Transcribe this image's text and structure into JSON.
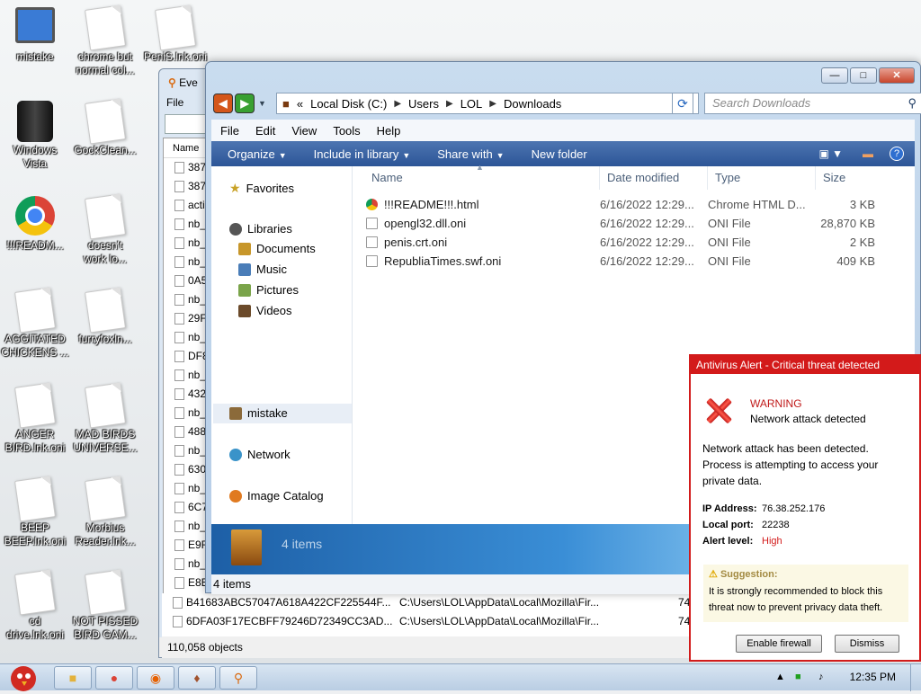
{
  "desktop": {
    "icons": [
      {
        "label": "mistake",
        "kind": "monitor"
      },
      {
        "label": "chrome but\nnormal col...",
        "kind": "page"
      },
      {
        "label": "PeniS.lnk.oni",
        "kind": "page"
      },
      {
        "label": "Windows\nVista",
        "kind": "can"
      },
      {
        "label": "GockClean...",
        "kind": "page"
      },
      {
        "label": "!!!READM...",
        "kind": "chrome"
      },
      {
        "label": "doesn't\nwork lo...",
        "kind": "page"
      },
      {
        "label": "AGGITATED\nCHICKENS ...",
        "kind": "page"
      },
      {
        "label": "furryfoxln...",
        "kind": "page"
      },
      {
        "label": "ANGER\nBIRD.lnk.oni",
        "kind": "page"
      },
      {
        "label": "MAD BIRDS\nUNIVERSE...",
        "kind": "page"
      },
      {
        "label": "BEEP\nBEEP.lnk.oni",
        "kind": "page"
      },
      {
        "label": "Morbius\nReader.lnk...",
        "kind": "page"
      },
      {
        "label": "cd\ndrive.lnk.oni",
        "kind": "page"
      },
      {
        "label": "NOT PISSED\nBIRD GAM...",
        "kind": "page"
      }
    ]
  },
  "everything": {
    "title": "Eve",
    "menu_file": "File",
    "col_name": "Name",
    "rows": [
      "387",
      "387",
      "acti",
      "nb_",
      "nb_",
      "nb_",
      "0A5",
      "nb_",
      "29F",
      "nb_",
      "DF8",
      "nb_",
      "432",
      "nb_",
      "488",
      "nb_",
      "630",
      "nb_",
      "6C7",
      "nb_",
      "E9F",
      "nb_",
      "E8E"
    ],
    "long_rows": [
      {
        "name": "B41683ABC57047A618A422CF225544F...",
        "path": "C:\\Users\\LOL\\AppData\\Local\\Mozilla\\Fir...",
        "size": "74"
      },
      {
        "name": "6DFA03F17ECBFF79246D72349CC3AD...",
        "path": "C:\\Users\\LOL\\AppData\\Local\\Mozilla\\Fir...",
        "size": "74"
      }
    ],
    "status": "110,058 objects"
  },
  "explorer": {
    "breadcrumb": [
      "Local Disk (C:)",
      "Users",
      "LOL",
      "Downloads"
    ],
    "breadcrumb_prefix": "«",
    "search_placeholder": "Search Downloads",
    "menu": [
      "File",
      "Edit",
      "View",
      "Tools",
      "Help"
    ],
    "toolbar": [
      "Organize",
      "Include in library",
      "Share with",
      "New folder"
    ],
    "nav": {
      "favorites": "Favorites",
      "libraries": "Libraries",
      "documents": "Documents",
      "music": "Music",
      "pictures": "Pictures",
      "videos": "Videos",
      "mistake": "mistake",
      "network": "Network",
      "image_catalog": "Image Catalog"
    },
    "columns": [
      "Name",
      "Date modified",
      "Type",
      "Size"
    ],
    "files": [
      {
        "name": "!!!README!!!.html",
        "date": "6/16/2022 12:29...",
        "type": "Chrome HTML D...",
        "size": "3 KB",
        "icon": "chrome-icon"
      },
      {
        "name": "opengl32.dll.oni",
        "date": "6/16/2022 12:29...",
        "type": "ONI File",
        "size": "28,870 KB",
        "icon": "file-icon"
      },
      {
        "name": "penis.crt.oni",
        "date": "6/16/2022 12:29...",
        "type": "ONI File",
        "size": "2 KB",
        "icon": "file-icon"
      },
      {
        "name": "RepubliaTimes.swf.oni",
        "date": "6/16/2022 12:29...",
        "type": "ONI File",
        "size": "409 KB",
        "icon": "file-icon"
      }
    ],
    "details_count": "4 items",
    "status": "4 items"
  },
  "antivirus": {
    "title": "Antivirus Alert - Critical threat detected",
    "warning": "WARNING",
    "subtitle": "Network attack detected",
    "message": "Network attack has been detected. Process is attempting to access your private data.",
    "ip_label": "IP Address:",
    "ip_value": "76.38.252.176",
    "port_label": "Local port:",
    "port_value": "22238",
    "level_label": "Alert level:",
    "level_value": "High",
    "suggestion_head": "Suggestion:",
    "suggestion_body": "It is strongly recommended to block this threat now to prevent privacy data theft.",
    "btn_enable": "Enable firewall",
    "btn_dismiss": "Dismiss",
    "accent": "#d31a1a"
  },
  "taskbar": {
    "clock": "12:35 PM"
  }
}
